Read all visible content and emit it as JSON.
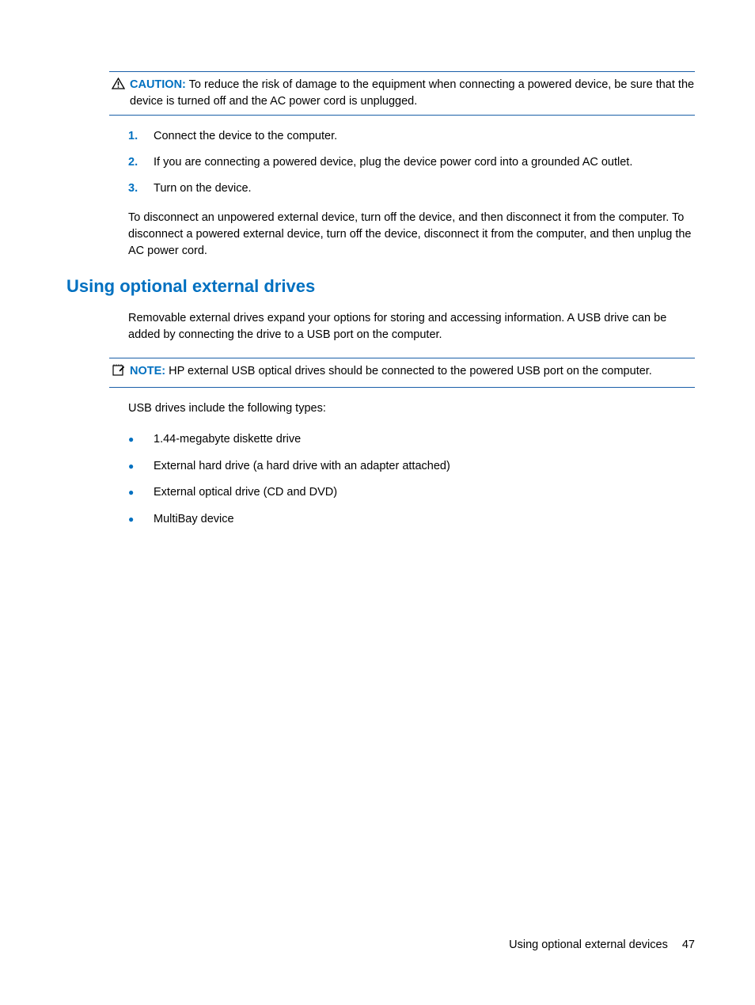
{
  "caution": {
    "label": "CAUTION:",
    "text": "To reduce the risk of damage to the equipment when connecting a powered device, be sure that the device is turned off and the AC power cord is unplugged."
  },
  "steps": {
    "n1": "1.",
    "t1": "Connect the device to the computer.",
    "n2": "2.",
    "t2": "If you are connecting a powered device, plug the device power cord into a grounded AC outlet.",
    "n3": "3.",
    "t3": "Turn on the device."
  },
  "disconnect_para": "To disconnect an unpowered external device, turn off the device, and then disconnect it from the computer. To disconnect a powered external device, turn off the device, disconnect it from the computer, and then unplug the AC power cord.",
  "heading": "Using optional external drives",
  "removable_para": "Removable external drives expand your options for storing and accessing information. A USB drive can be added by connecting the drive to a USB port on the computer.",
  "note": {
    "label": "NOTE:",
    "text": "HP external USB optical drives should be connected to the powered USB port on the computer."
  },
  "usb_intro": "USB drives include the following types:",
  "bullets": {
    "b1": "1.44-megabyte diskette drive",
    "b2": "External hard drive (a hard drive with an adapter attached)",
    "b3": "External optical drive (CD and DVD)",
    "b4": "MultiBay device"
  },
  "footer": {
    "section": "Using optional external devices",
    "page": "47"
  }
}
